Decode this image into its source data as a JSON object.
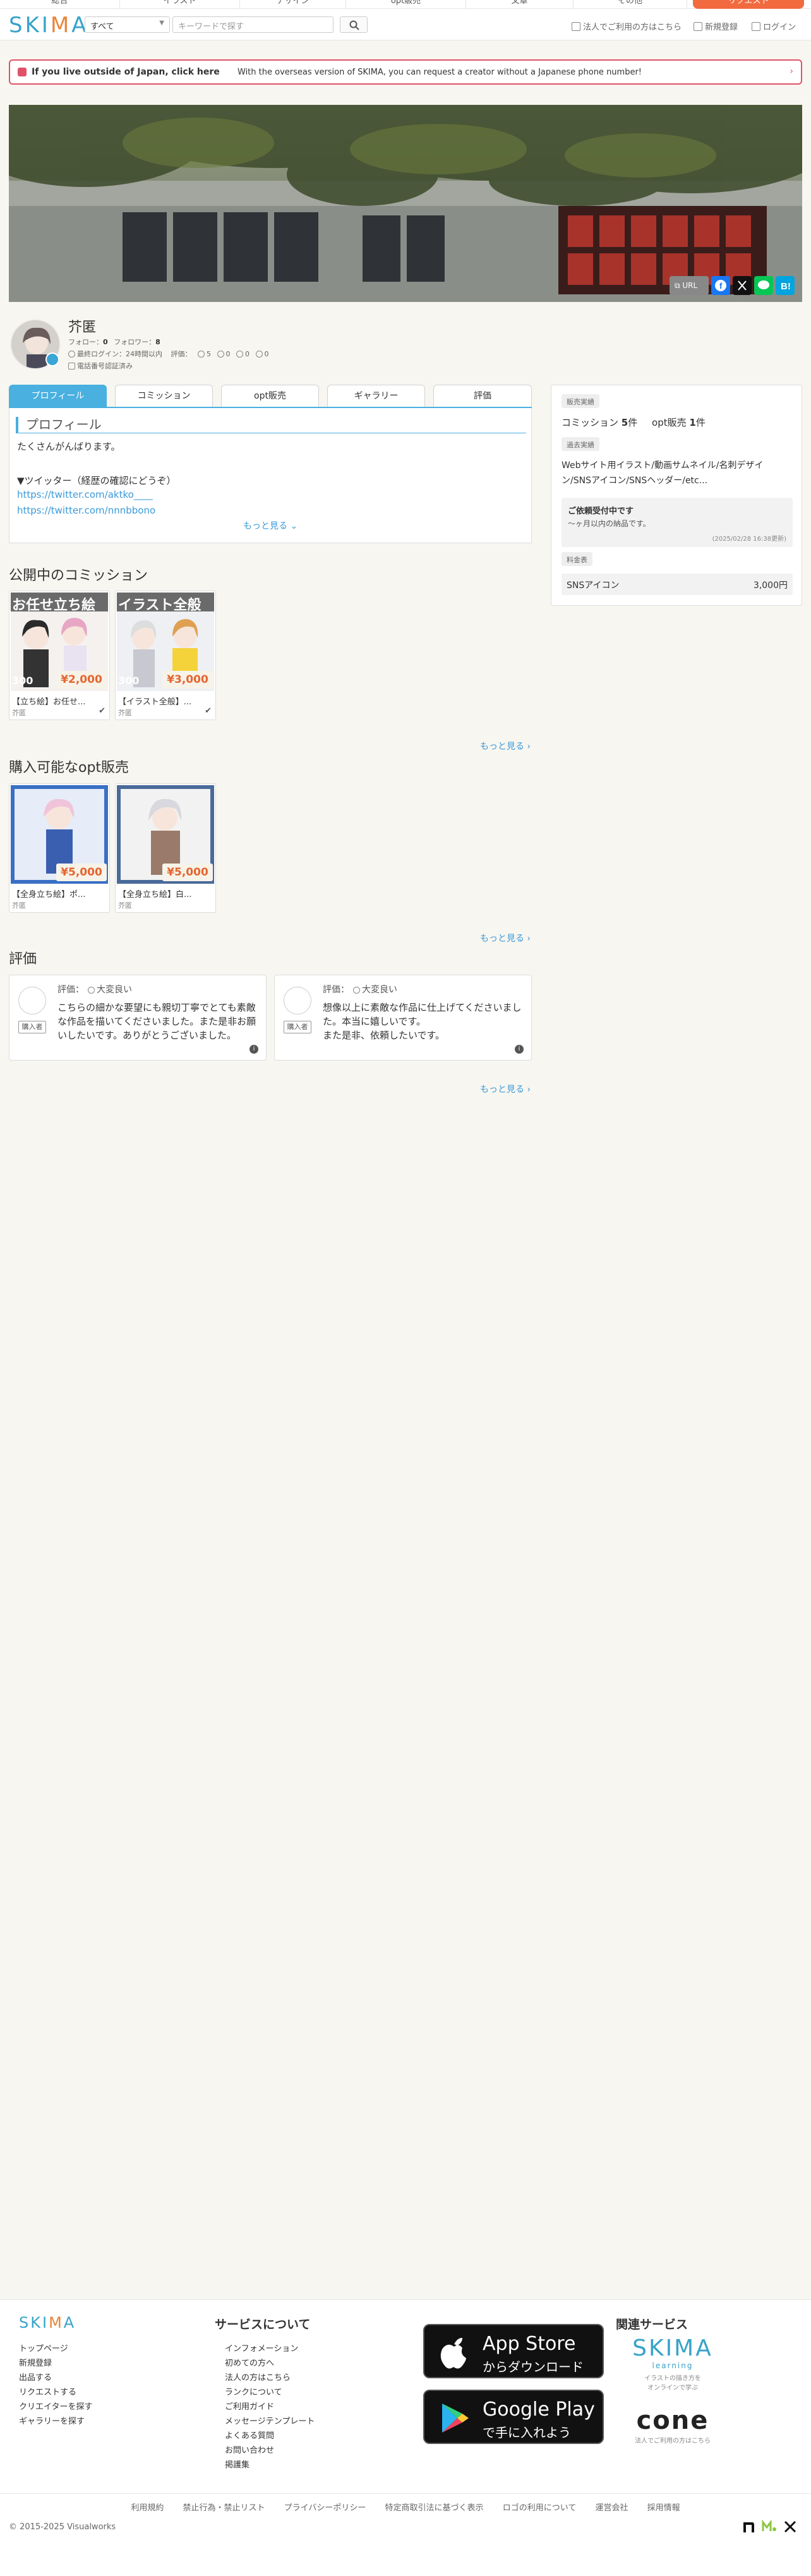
{
  "nav": {
    "tabs": [
      ""
    ],
    "tab_labels": [
      "総合",
      "イラスト",
      "デザイン",
      "opt販売",
      "文章",
      "その他"
    ],
    "request_label": "リクエスト"
  },
  "header": {
    "logo_main": "SKI",
    "logo_k": "M",
    "logo_tail": "A",
    "category_value": "すべて",
    "search_placeholder": "キーワードで探す",
    "corporate_link": "法人でご利用の方はこちら",
    "register_link": "新規登録",
    "login_link": "ログイン"
  },
  "banner": {
    "bold": "If you live outside of Japan, click here",
    "desc": "With the overseas version of SKIMA, you can request a creator without a Japanese phone number!"
  },
  "share": {
    "url_label": "URL"
  },
  "profile": {
    "name": "芥匿",
    "follow_label": "フォロー：",
    "follow_count": "0",
    "follower_label": "フォロワー：",
    "follower_count": "8",
    "last_login": "最終ログイン：24時間以内",
    "rating_label": "評価：",
    "rating_good": "5",
    "rating_normal": "0",
    "rating_bad": "0",
    "rating_other": "0",
    "phone_verified": "電話番号認証済み"
  },
  "tabs": [
    "プロフィール",
    "コミッション",
    "opt販売",
    "ギャラリー",
    "評価"
  ],
  "about": {
    "heading": "プロフィール",
    "line1": "たくさんがんばります。",
    "line2": "▼ツイッター（経歴の確認にどうぞ）",
    "link1": "https://twitter.com/aktko____",
    "link2": "https://twitter.com/nnnbbono",
    "more": "もっと見る ⌄"
  },
  "sidebar": {
    "sales_chip": "販売実績",
    "commission_label": "コミッション",
    "commission_count": "5",
    "commission_unit": "件",
    "opt_label": "opt販売",
    "opt_count": "1",
    "opt_unit": "件",
    "past_chip": "過去実績",
    "past_line1": "Webサイト用イラスト/動画サムネイル/名刺デザイ",
    "past_line2": "ン/SNSアイコン/SNSヘッダー/etc...",
    "status_title": "ご依頼受付中です",
    "status_sub": "〜ヶ月以内の納品です。",
    "status_date": "(2025/02/28 16:38更新)",
    "price_chip": "料金表",
    "price_item": "SNSアイコン",
    "price_value": "3,000円"
  },
  "commissions": {
    "title": "公開中のコミッション",
    "more": "もっと見る ›",
    "cards": [
      {
        "banner": "お任せ立ち絵",
        "price": "¥2,000",
        "title": "【立ち絵】お任せ...",
        "author": "芥匿",
        "sold": "300"
      },
      {
        "banner": "イラスト全般",
        "price": "¥3,000",
        "title": "【イラスト全般】...",
        "author": "芥匿",
        "sold": "300"
      }
    ]
  },
  "opt": {
    "title": "購入可能なopt販売",
    "more": "もっと見る ›",
    "cards": [
      {
        "price": "¥5,000",
        "title": "【全身立ち絵】ポ...",
        "author": "芥匿"
      },
      {
        "price": "¥5,000",
        "title": "【全身立ち絵】白...",
        "author": "芥匿"
      }
    ]
  },
  "reviews": {
    "title": "評価",
    "more": "もっと見る ›",
    "items": [
      {
        "role": "購入者",
        "rating_label": "評価：",
        "rating": "大変良い",
        "line1": "こちらの細かな要望にも親切丁寧でとても素敵",
        "line2": "な作品を描いてくださいました。また是非お願",
        "line3": "いしたいです。ありがとうございました。"
      },
      {
        "role": "購入者",
        "rating_label": "評価：",
        "rating": "大変良い",
        "line1": "想像以上に素敵な作品に仕上げてくださいまし",
        "line2": "た。本当に嬉しいです。",
        "line3": "また是非、依頼したいです。"
      }
    ]
  },
  "footer": {
    "col1": [
      "トップページ",
      "新規登録",
      "出品する",
      "リクエストする",
      "クリエイターを探す",
      "ギャラリーを探す"
    ],
    "services_title": "サービスについて",
    "col2": [
      "インフォメーション",
      "初めての方へ",
      "法人の方はこちら",
      "ランクについて",
      "ご利用ガイド",
      "メッセージテンプレート",
      "よくある質問",
      "お問い合わせ",
      "掲護集"
    ],
    "app_store_big": "App Store",
    "app_store_small": "からダウンロード",
    "google_big": "Google Play",
    "google_small": "で手に入れよう",
    "related_title": "関連サービス",
    "learning_main": "SKIMA",
    "learning_sub": "learning",
    "learning_desc1": "イラストの描き方を",
    "learning_desc2": "オンラインで学ぶ",
    "cone": "cone",
    "cone_desc": "法人でご利用の方はこちら",
    "bottom_links": [
      "利用規約",
      "禁止行為・禁止リスト",
      "プライバシーポリシー",
      "特定商取引法に基づく表示",
      "ロゴの利用について",
      "運営会社",
      "採用情報"
    ],
    "copyright": "© 2015-2025 Visualworks"
  },
  "colors": {
    "accent": "#49b0e0",
    "request": "#f26a3f",
    "banner_border": "#e0526a",
    "logo": "#38a3c9"
  }
}
